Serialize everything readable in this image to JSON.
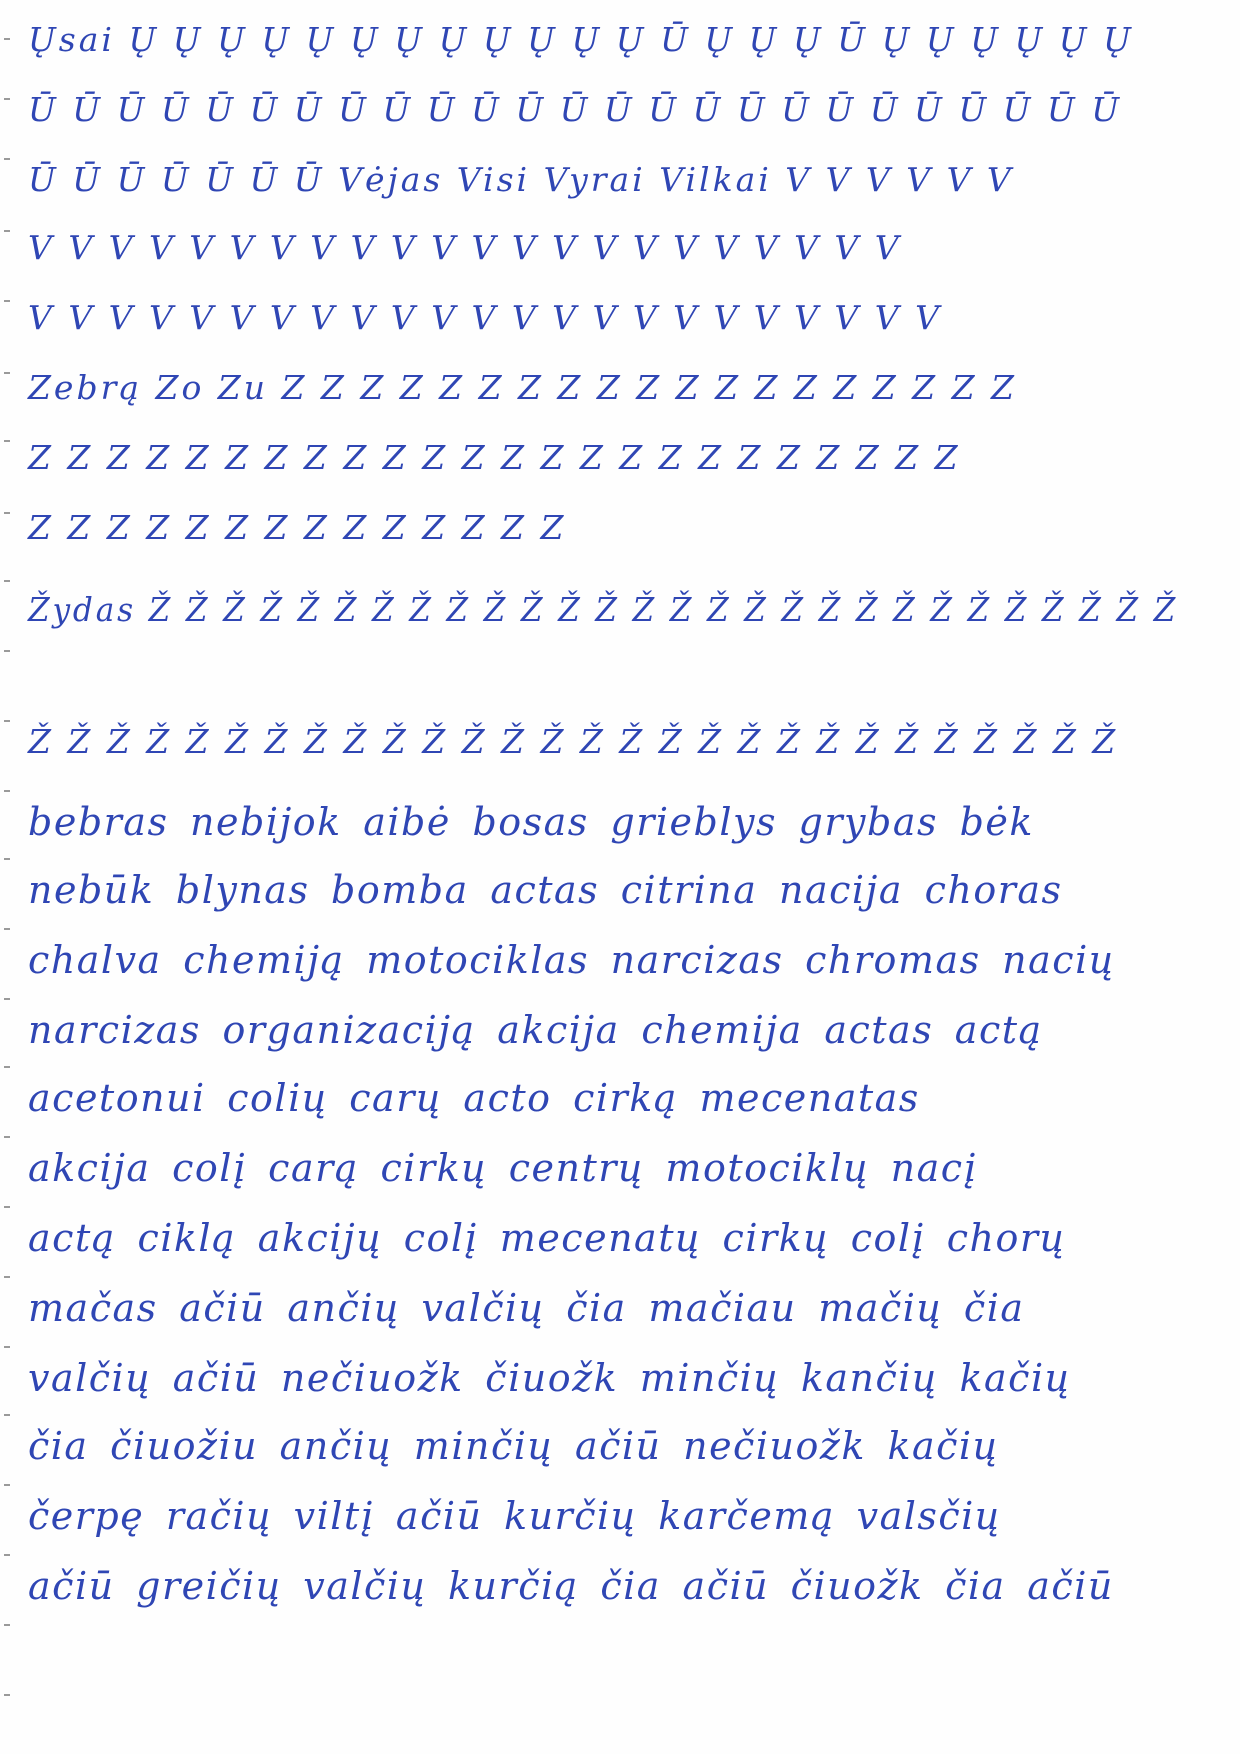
{
  "page": {
    "ink_color": "#2f46b4",
    "paper_color": "#fefefe",
    "lines": [
      "Ųsai Ų Ų Ų Ų Ų Ų Ų Ų Ų Ų Ų Ų Ū Ų Ų Ų Ū Ų Ų Ų Ų Ų Ų",
      "Ū Ū Ū Ū Ū Ū Ū Ū Ū Ū Ū Ū Ū Ū Ū Ū Ū Ū Ū Ū Ū Ū Ū Ū Ū",
      "Ū Ū Ū Ū Ū Ū Ū Vėjas Visi Vyrai Vilkai V V V V V V",
      "V V V V V V V V V V V V V V V V V V V V V V",
      "V V V V V V V V V V V V V V V V V V V V V V V",
      "Zebrą Zo Zu Z Z Z Z Z Z Z Z Z Z Z Z Z Z Z Z Z Z Z",
      "Z Z Z Z Z Z Z Z Z Z Z Z Z Z Z Z Z Z Z Z Z Z Z Z",
      "Z Z Z Z Z Z Z Z Z Z Z Z Z Z",
      "Žydas Ž Ž Ž Ž Ž Ž Ž Ž Ž Ž Ž Ž Ž Ž Ž Ž Ž Ž Ž Ž Ž Ž Ž Ž Ž Ž Ž Ž",
      "Ž Ž Ž Ž Ž Ž Ž Ž Ž Ž Ž Ž Ž Ž Ž Ž Ž Ž Ž Ž Ž Ž Ž Ž Ž Ž Ž Ž",
      "bebras nebijok aibė bosas grieblys grybas bėk",
      "nebūk blynas bomba actas citrina nacija choras",
      "chalva chemiją motociklas narcizas chromas nacių",
      "narcizas organizaciją akcija chemija actas actą",
      "acetonui colių carų acto cirką mecenatas",
      "akcija colį carą cirkų centrų motociklų nacį",
      "actą ciklą akcijų colį mecenatų cirkų colį chorų",
      "mačas ačiū ančių valčių čia mačiau mačių čia",
      "valčių ačiū nečiuožk čiuožk minčių kančių kačių",
      "čia čiuožiu ančių minčių ačiū nečiuožk kačių",
      "čerpę račių viltį ačiū kurčių karčemą valsčių",
      "ačiū greičių valčių kurčią čia ačiū čiuožk čia ačiū"
    ]
  }
}
